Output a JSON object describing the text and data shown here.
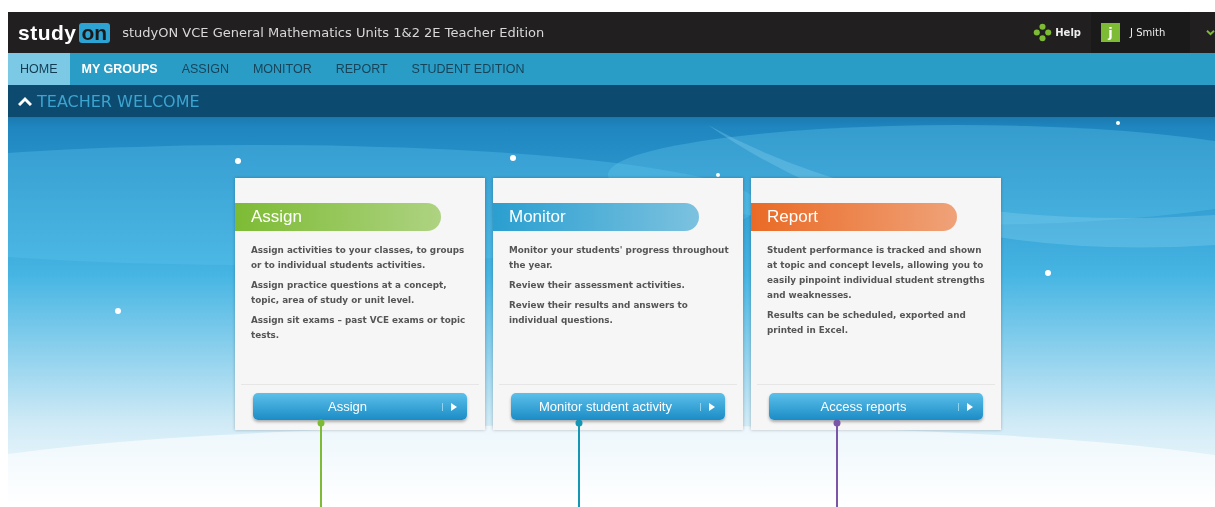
{
  "header": {
    "logo_text": "study",
    "logo_badge": "on",
    "title": "studyON VCE General Mathematics Units 1&2 2E Teacher Edition",
    "help": "Help",
    "avatar_letter": "j",
    "user": "J Smith"
  },
  "nav": [
    {
      "label": "HOME",
      "selected": true,
      "highlighted": false
    },
    {
      "label": "MY GROUPS",
      "selected": false,
      "highlighted": true
    },
    {
      "label": "ASSIGN",
      "selected": false,
      "highlighted": false
    },
    {
      "label": "MONITOR",
      "selected": false,
      "highlighted": false
    },
    {
      "label": "REPORT",
      "selected": false,
      "highlighted": false
    },
    {
      "label": "STUDENT EDITION",
      "selected": false,
      "highlighted": false
    }
  ],
  "section": {
    "title": "TEACHER WELCOME",
    "expanded": true
  },
  "cards": [
    {
      "title": "Assign",
      "color": "#7dbb34",
      "paragraphs": [
        "Assign activities to your classes, to groups or to individual students activities.",
        "Assign practice questions at a concept, topic, area of study or unit level.",
        "Assign sit exams – past VCE exams or topic tests."
      ],
      "button": "Assign",
      "leader": {
        "color": "#7dbb34"
      }
    },
    {
      "title": "Monitor",
      "color": "#2a9fd0",
      "paragraphs": [
        "Monitor your students' progress throughout the year.",
        "Review their assessment activities.",
        "Review their results and answers to individual questions."
      ],
      "button": "Monitor student activity",
      "leader": {
        "color": "#1596b5"
      }
    },
    {
      "title": "Report",
      "color": "#ea6a25",
      "paragraphs": [
        "Student performance is tracked and shown at topic and concept levels, allowing you to easily pinpoint individual student strengths and weaknesses.",
        "Results can be scheduled, exported and printed in Excel."
      ],
      "button": "Access reports",
      "leader": {
        "color": "#7a55a8"
      }
    }
  ]
}
